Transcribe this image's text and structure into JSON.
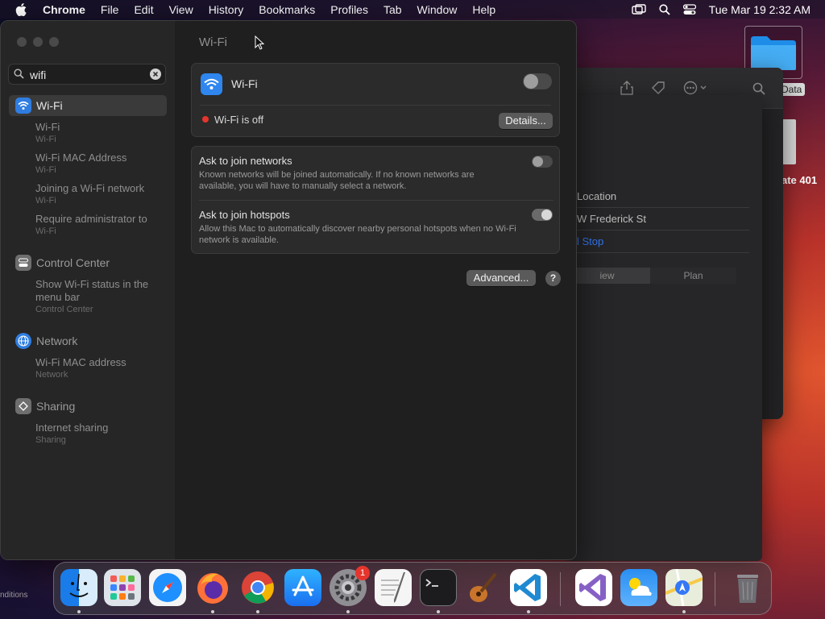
{
  "menubar": {
    "app_name": "Chrome",
    "items": [
      "File",
      "Edit",
      "View",
      "History",
      "Bookmarks",
      "Profiles",
      "Tab",
      "Window",
      "Help"
    ],
    "clock": "Tue Mar 19  2:32 AM"
  },
  "desktop": {
    "folder_label": "Data",
    "file_label": "ate 401",
    "bottom_text": "nditions"
  },
  "background_window": {
    "rows": [
      "Location",
      "W Frederick St",
      "l Stop"
    ],
    "segments": [
      "iew",
      "Plan"
    ]
  },
  "search": {
    "value": "wifi",
    "placeholder": "Search"
  },
  "sidebar": {
    "groups": [
      {
        "label": "Wi-Fi",
        "icon": "wifi-icon",
        "color": "#2f7de1",
        "selected": true,
        "subs": [
          {
            "title": "Wi-Fi",
            "sub": "Wi-Fi"
          },
          {
            "title": "Wi-Fi MAC Address",
            "sub": "Wi-Fi"
          },
          {
            "title": "Joining a Wi-Fi network",
            "sub": "Wi-Fi"
          },
          {
            "title": "Require administrator to",
            "sub": "Wi-Fi"
          }
        ]
      },
      {
        "label": "Control Center",
        "icon": "control-center-icon",
        "color": "#6e6e6e",
        "subs": [
          {
            "title": "Show Wi-Fi status in the menu bar",
            "sub": "Control Center"
          }
        ]
      },
      {
        "label": "Network",
        "icon": "globe-icon",
        "color": "#2f7de1",
        "subs": [
          {
            "title": "Wi-Fi MAC address",
            "sub": "Network"
          }
        ]
      },
      {
        "label": "Sharing",
        "icon": "sharing-icon",
        "color": "#6e6e6e",
        "subs": [
          {
            "title": "Internet sharing",
            "sub": "Sharing"
          }
        ]
      }
    ]
  },
  "content": {
    "title": "Wi-Fi",
    "wifi_card": {
      "label": "Wi-Fi",
      "toggle_on": false,
      "status_text": "Wi-Fi is off",
      "status_color": "#e5352c",
      "details_button": "Details..."
    },
    "options": [
      {
        "title": "Ask to join networks",
        "desc": "Known networks will be joined automatically. If no known networks are available, you will have to manually select a network.",
        "toggle_on": false
      },
      {
        "title": "Ask to join hotspots",
        "desc": "Allow this Mac to automatically discover nearby personal hotspots when no Wi-Fi network is available.",
        "toggle_on": true
      }
    ],
    "advanced_button": "Advanced...",
    "help_button": "?"
  },
  "dock": {
    "apps": [
      "Finder",
      "Launchpad",
      "Safari",
      "Firefox",
      "Google Chrome",
      "App Store",
      "System Settings",
      "TextEdit",
      "Terminal",
      "GarageBand",
      "Visual Studio Code",
      "Visual Studio",
      "Weather",
      "Maps",
      "Trash"
    ],
    "settings_badge": "1"
  }
}
